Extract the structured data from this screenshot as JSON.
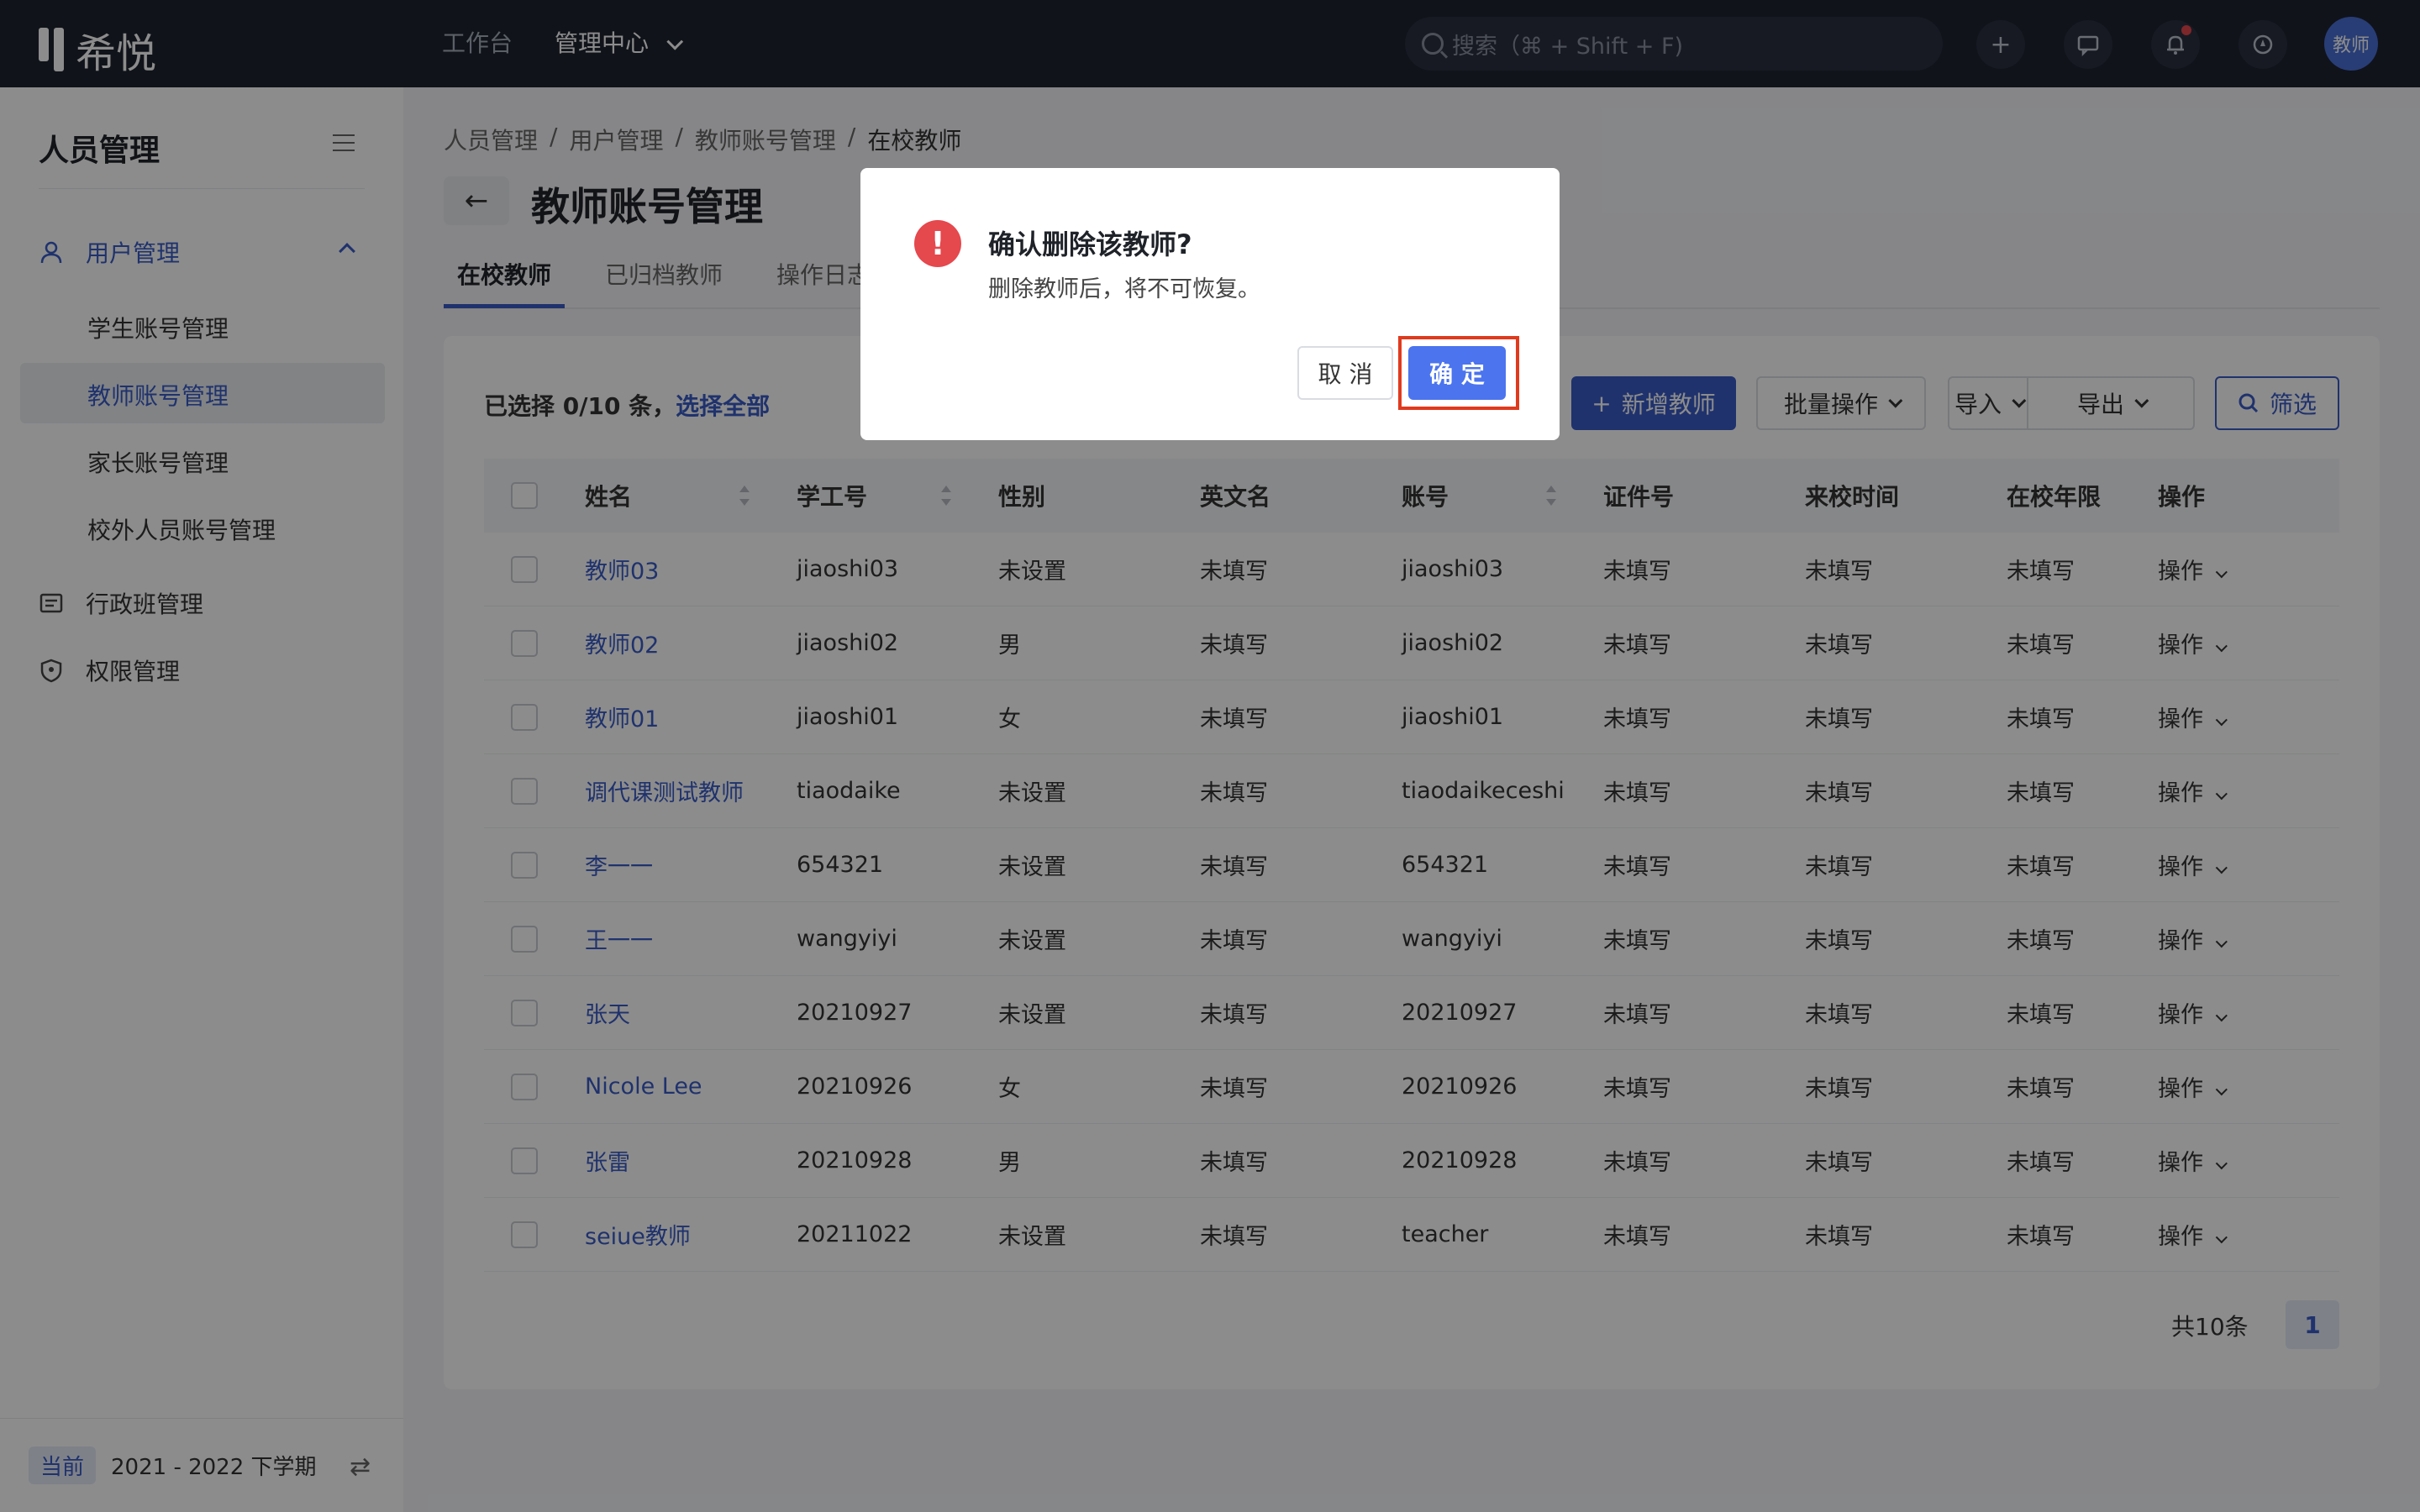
{
  "app": {
    "logo_text": "希悦",
    "avatar_text": "教师"
  },
  "topnav": {
    "workbench": "工作台",
    "admin_center": "管理中心"
  },
  "search": {
    "placeholder": "搜索（⌘ + Shift + F)"
  },
  "icons": {
    "add": "plus-icon",
    "message": "message-icon",
    "bell": "bell-icon",
    "compass": "compass-icon"
  },
  "sidebar": {
    "title": "人员管理",
    "groups": [
      {
        "label": "用户管理",
        "icon": "user-icon",
        "active": true
      },
      {
        "label": "行政班管理",
        "icon": "list-icon"
      },
      {
        "label": "权限管理",
        "icon": "shield-icon"
      }
    ],
    "sub_items": [
      {
        "label": "学生账号管理"
      },
      {
        "label": "教师账号管理",
        "active": true
      },
      {
        "label": "家长账号管理"
      },
      {
        "label": "校外人员账号管理"
      }
    ],
    "term_tag": "当前",
    "term": "2021 - 2022 下学期"
  },
  "breadcrumb": [
    "人员管理",
    "用户管理",
    "教师账号管理",
    "在校教师"
  ],
  "page_title": "教师账号管理",
  "tabs": [
    "在校教师",
    "已归档教师",
    "操作日志"
  ],
  "toolbar": {
    "selected_prefix": "已选择 0/10 条，",
    "select_all": "选择全部",
    "add_teacher": "新增教师",
    "batch_ops": "批量操作",
    "import": "导入",
    "export": "导出",
    "filter": "筛选"
  },
  "table": {
    "headers": [
      "姓名",
      "学工号",
      "性别",
      "英文名",
      "账号",
      "证件号",
      "来校时间",
      "在校年限",
      "操作"
    ],
    "rows": [
      {
        "name": "教师03",
        "id": "jiaoshi03",
        "gender": "未设置",
        "en": "未填写",
        "account": "jiaoshi03",
        "cert": "未填写",
        "arrival": "未填写",
        "years": "未填写",
        "op": "操作"
      },
      {
        "name": "教师02",
        "id": "jiaoshi02",
        "gender": "男",
        "en": "未填写",
        "account": "jiaoshi02",
        "cert": "未填写",
        "arrival": "未填写",
        "years": "未填写",
        "op": "操作"
      },
      {
        "name": "教师01",
        "id": "jiaoshi01",
        "gender": "女",
        "en": "未填写",
        "account": "jiaoshi01",
        "cert": "未填写",
        "arrival": "未填写",
        "years": "未填写",
        "op": "操作"
      },
      {
        "name": "调代课测试教师",
        "id": "tiaodaike",
        "gender": "未设置",
        "en": "未填写",
        "account": "tiaodaikeceshi",
        "cert": "未填写",
        "arrival": "未填写",
        "years": "未填写",
        "op": "操作"
      },
      {
        "name": "李一一",
        "id": "654321",
        "gender": "未设置",
        "en": "未填写",
        "account": "654321",
        "cert": "未填写",
        "arrival": "未填写",
        "years": "未填写",
        "op": "操作"
      },
      {
        "name": "王一一",
        "id": "wangyiyi",
        "gender": "未设置",
        "en": "未填写",
        "account": "wangyiyi",
        "cert": "未填写",
        "arrival": "未填写",
        "years": "未填写",
        "op": "操作"
      },
      {
        "name": "张天",
        "id": "20210927",
        "gender": "未设置",
        "en": "未填写",
        "account": "20210927",
        "cert": "未填写",
        "arrival": "未填写",
        "years": "未填写",
        "op": "操作"
      },
      {
        "name": "Nicole Lee",
        "id": "20210926",
        "gender": "女",
        "en": "未填写",
        "account": "20210926",
        "cert": "未填写",
        "arrival": "未填写",
        "years": "未填写",
        "op": "操作"
      },
      {
        "name": "张雷",
        "id": "20210928",
        "gender": "男",
        "en": "未填写",
        "account": "20210928",
        "cert": "未填写",
        "arrival": "未填写",
        "years": "未填写",
        "op": "操作"
      },
      {
        "name": "seiue教师",
        "id": "20211022",
        "gender": "未设置",
        "en": "未填写",
        "account": "teacher",
        "cert": "未填写",
        "arrival": "未填写",
        "years": "未填写",
        "op": "操作"
      }
    ]
  },
  "pagination": {
    "total": "共10条",
    "current": "1"
  },
  "modal": {
    "title": "确认删除该教师?",
    "text": "删除教师后，将不可恢复。",
    "cancel": "取 消",
    "ok": "确 定"
  },
  "colors": {
    "accent": "#3a5bc7",
    "danger": "#e5484d",
    "highlight_frame": "#e03a1e"
  }
}
